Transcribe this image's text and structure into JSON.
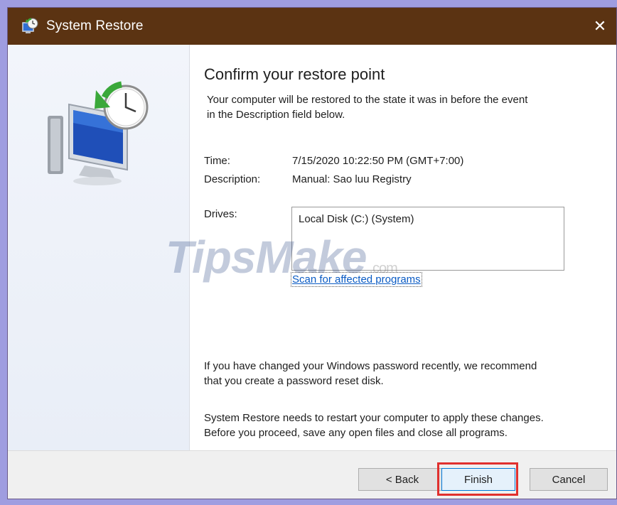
{
  "window": {
    "title": "System Restore",
    "close_symbol": "✕",
    "icon": "system-restore-icon"
  },
  "page": {
    "heading": "Confirm your restore point",
    "intro_line1": "Your computer will be restored to the state it was in before the event",
    "intro_line2": "in the Description field below."
  },
  "details": {
    "time_label": "Time:",
    "time_value": "7/15/2020 10:22:50 PM (GMT+7:00)",
    "description_label": "Description:",
    "description_value": "Manual: Sao luu Registry",
    "drives_label": "Drives:",
    "drives": [
      "Local Disk (C:) (System)"
    ]
  },
  "scan_link": "Scan for affected programs",
  "watermark": {
    "text": "TipsMake",
    "suffix": ".com"
  },
  "notes": {
    "password_line1": "If you have changed your Windows password recently, we recommend",
    "password_line2": "that you create a password reset disk.",
    "restart_line1": "System Restore needs to restart your computer to apply these changes.",
    "restart_line2": "Before you proceed, save any open files and close all programs."
  },
  "buttons": {
    "back": "< Back",
    "finish": "Finish",
    "cancel": "Cancel"
  },
  "colors": {
    "titlebar": "#5b3312",
    "outer_frame": "#9f9de0",
    "highlight": "#e0302e",
    "link": "#0a5bc4"
  }
}
